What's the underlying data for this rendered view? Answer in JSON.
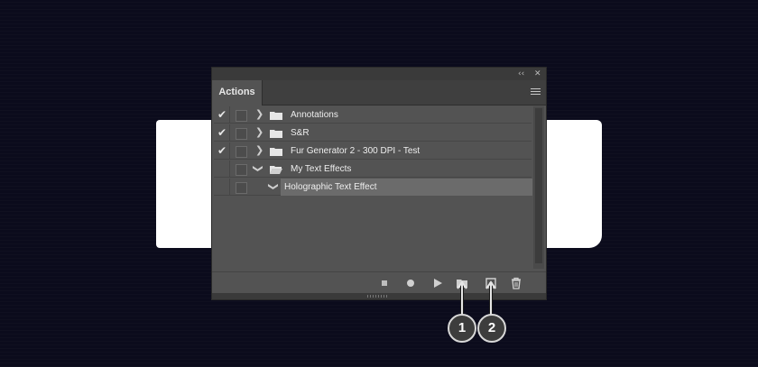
{
  "panel": {
    "titlebar_buttons": {
      "collapse": "‹‹",
      "close": "✕"
    },
    "tab_label": "Actions",
    "menu_icon": "panel-menu-icon"
  },
  "actions": [
    {
      "label": "Annotations",
      "checked": true,
      "expanded": false,
      "type": "set"
    },
    {
      "label": "S&R",
      "checked": true,
      "expanded": false,
      "type": "set"
    },
    {
      "label": "Fur Generator 2 - 300 DPI - Test",
      "checked": true,
      "expanded": false,
      "type": "set"
    },
    {
      "label": "My Text Effects",
      "checked": false,
      "expanded": true,
      "type": "set"
    },
    {
      "label": "Holographic Text Effect",
      "checked": false,
      "expanded": false,
      "type": "action",
      "selected": true
    }
  ],
  "toolbar": {
    "buttons": [
      "stop-icon",
      "record-icon",
      "play-icon",
      "new-set-icon",
      "new-action-icon",
      "trash-icon"
    ]
  },
  "callouts": {
    "first": "1",
    "second": "2"
  },
  "colors": {
    "background": "#0b0b1c",
    "panel": "#535353",
    "selected_row": "#6b6b6b"
  }
}
